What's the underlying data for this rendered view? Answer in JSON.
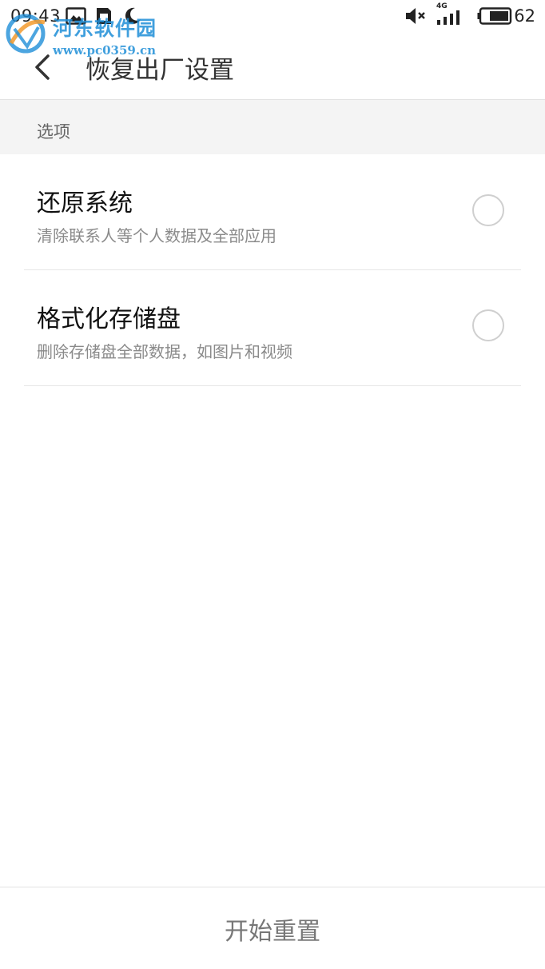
{
  "status_bar": {
    "time": "09:43",
    "network_label": "4G",
    "battery_level": "62",
    "icons": [
      "image-icon",
      "sim-card-icon",
      "moon-icon",
      "mute-icon",
      "signal-icon",
      "battery-icon"
    ]
  },
  "watermark": {
    "title": "河东软件园",
    "url": "www.pc0359.cn"
  },
  "header": {
    "title": "恢复出厂设置",
    "back_icon": "chevron-left-icon"
  },
  "section": {
    "label": "选项"
  },
  "options": [
    {
      "title": "还原系统",
      "subtitle": "清除联系人等个人数据及全部应用",
      "selected": false
    },
    {
      "title": "格式化存储盘",
      "subtitle": "删除存储盘全部数据，如图片和视频",
      "selected": false
    }
  ],
  "footer": {
    "button_label": "开始重置"
  },
  "colors": {
    "accent_watermark": "#1f8fd8",
    "text_primary": "#111111",
    "text_secondary": "#8a8a8a",
    "section_bg": "#f4f4f4",
    "radio_border": "#cfcfcf"
  }
}
